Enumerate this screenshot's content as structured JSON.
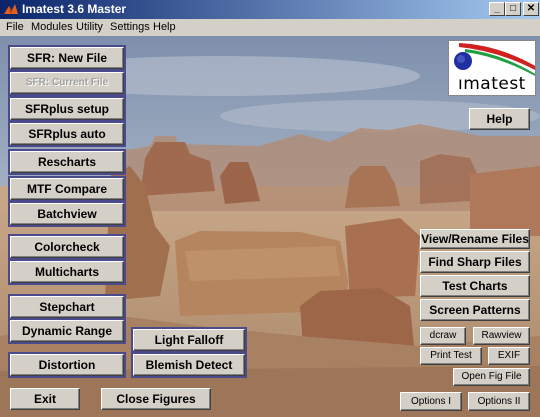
{
  "window": {
    "title": "Imatest 3.6  Master",
    "controls": [
      "_",
      "□",
      "✕"
    ]
  },
  "menu": [
    "File",
    "Modules",
    "Utility",
    "Settings",
    "Help"
  ],
  "logo": {
    "text": "ımatest"
  },
  "buttons": {
    "sfr_new": "SFR: New File",
    "sfr_current": "SFR: Current File",
    "sfrplus_setup": "SFRplus  setup",
    "sfrplus_auto": "SFRplus  auto",
    "rescharts": "Rescharts",
    "mtf_compare": "MTF Compare",
    "batchview": "Batchview",
    "colorcheck": "Colorcheck",
    "multicharts": "Multicharts",
    "stepchart": "Stepchart",
    "dynamic_range": "Dynamic Range",
    "distortion": "Distortion",
    "light_falloff": "Light Falloff",
    "blemish_detect": "Blemish Detect",
    "exit": "Exit",
    "close_figures": "Close Figures",
    "help": "Help",
    "view_rename": "View/Rename Files",
    "find_sharp": "Find Sharp Files",
    "test_charts": "Test Charts",
    "screen_patterns": "Screen Patterns",
    "dcraw": "dcraw",
    "rawview": "Rawview",
    "print_test": "Print Test",
    "exif": "EXIF",
    "open_fig": "Open Fig File",
    "options1": "Options I",
    "options2": "Options II"
  }
}
